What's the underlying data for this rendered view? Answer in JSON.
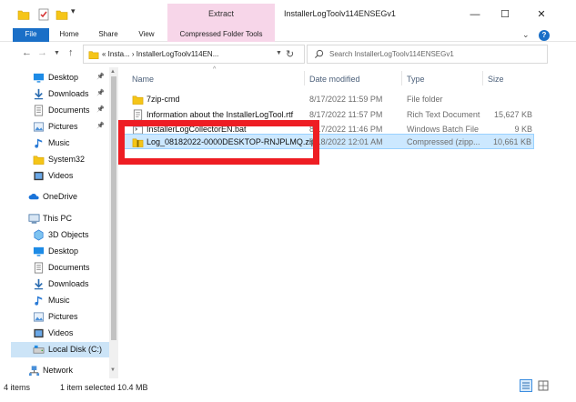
{
  "window": {
    "title": "InstallerLogToolv114ENSEGv1",
    "context_tab_group": "Extract",
    "controls": {
      "minimize": "—",
      "maximize": "☐",
      "close": "✕"
    }
  },
  "ribbon": {
    "tabs": [
      "File",
      "Home",
      "Share",
      "View",
      "Compressed Folder Tools"
    ],
    "help": "?"
  },
  "navigation": {
    "address_text": "« Insta... › InstallerLogToolv114EN...",
    "search_placeholder": "Search InstallerLogToolv114ENSEGv1"
  },
  "nav_pane": {
    "quick_access": [
      {
        "label": "Desktop",
        "icon": "desktop-blue-icon",
        "pinned": true
      },
      {
        "label": "Downloads",
        "icon": "download-arrow-icon",
        "pinned": true
      },
      {
        "label": "Documents",
        "icon": "documents-icon",
        "pinned": true
      },
      {
        "label": "Pictures",
        "icon": "pictures-icon",
        "pinned": true
      },
      {
        "label": "Music",
        "icon": "music-note-icon",
        "pinned": false
      },
      {
        "label": "System32",
        "icon": "folder-icon",
        "pinned": false
      },
      {
        "label": "Videos",
        "icon": "videos-icon",
        "pinned": false
      }
    ],
    "onedrive": "OneDrive",
    "this_pc": "This PC",
    "this_pc_items": [
      {
        "label": "3D Objects",
        "icon": "3d-objects-icon"
      },
      {
        "label": "Desktop",
        "icon": "desktop-blue-icon"
      },
      {
        "label": "Documents",
        "icon": "documents-icon"
      },
      {
        "label": "Downloads",
        "icon": "download-arrow-icon"
      },
      {
        "label": "Music",
        "icon": "music-note-icon"
      },
      {
        "label": "Pictures",
        "icon": "pictures-icon"
      },
      {
        "label": "Videos",
        "icon": "videos-icon"
      },
      {
        "label": "Local Disk (C:)",
        "icon": "drive-icon",
        "selected": true
      }
    ],
    "network": "Network"
  },
  "file_list": {
    "columns": [
      "Name",
      "Date modified",
      "Type",
      "Size"
    ],
    "rows": [
      {
        "name": "7zip-cmd",
        "date": "8/17/2022 11:59 PM",
        "type": "File folder",
        "size": "",
        "icon": "folder-icon",
        "selected": false
      },
      {
        "name": "Information about the InstallerLogTool.rtf",
        "date": "8/17/2022 11:57 PM",
        "type": "Rich Text Document",
        "size": "15,627 KB",
        "icon": "rtf-document-icon",
        "selected": false
      },
      {
        "name": "InstallerLogCollectorEN.bat",
        "date": "8/17/2022 11:46 PM",
        "type": "Windows Batch File",
        "size": "9 KB",
        "icon": "batch-file-icon",
        "selected": false
      },
      {
        "name": "Log_08182022-0000DESKTOP-RNJPLMQ.zip",
        "date": "8/18/2022 12:01 AM",
        "type": "Compressed (zipp...",
        "size": "10,661 KB",
        "icon": "zip-folder-icon",
        "selected": true
      }
    ]
  },
  "status_bar": {
    "items_count": "4 items",
    "selection": "1 item selected  10.4 MB"
  },
  "colors": {
    "accent": "#1a6fc7",
    "context_tab": "#f7d6e9",
    "selection": "#cce8ff",
    "highlight_box": "#ee1d23"
  }
}
